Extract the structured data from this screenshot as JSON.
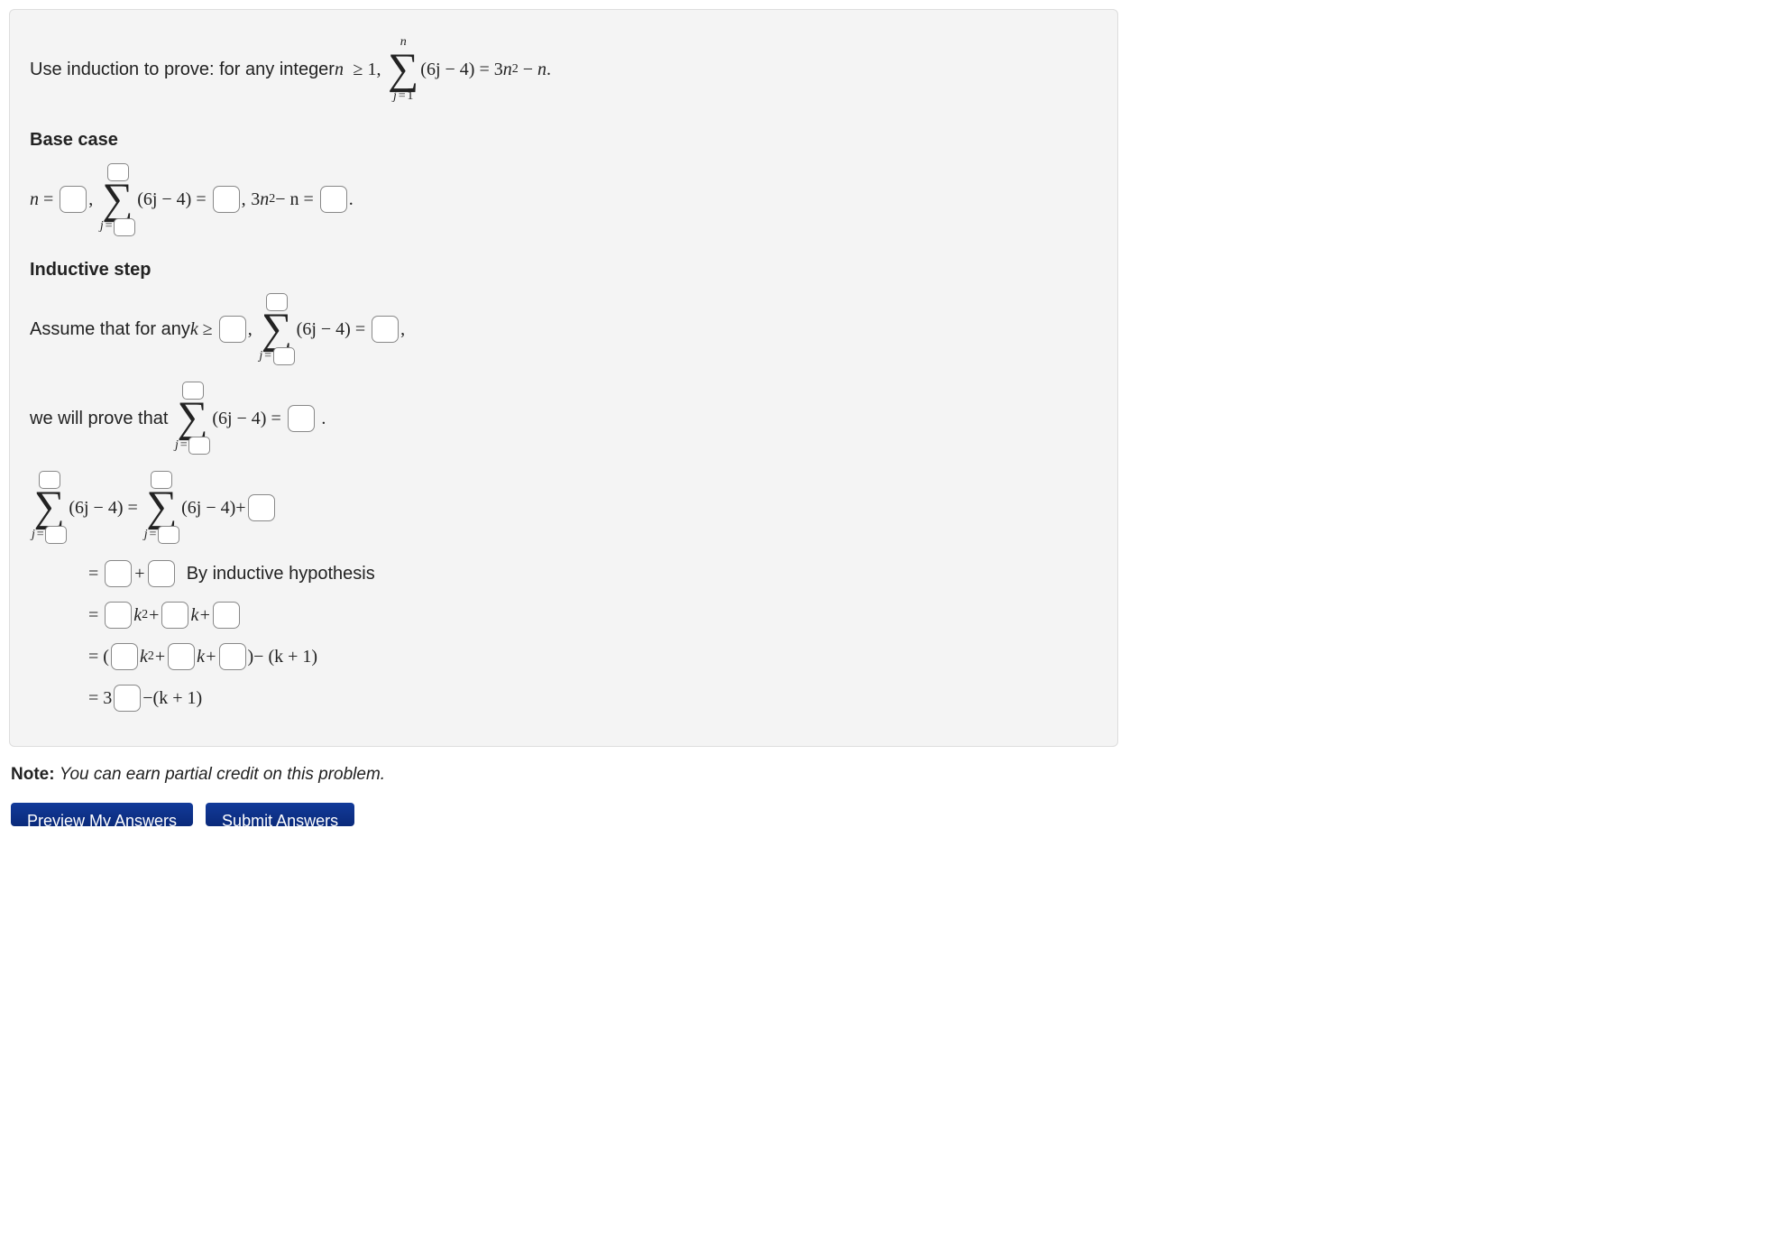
{
  "problem": {
    "prompt_prefix": "Use induction to prove: for any integer ",
    "var_n": "n",
    "geq": "≥",
    "one": "1",
    "comma": ",",
    "summand": "(6j − 4)",
    "eq": "=",
    "three": "3",
    "n_sq": "n",
    "sq": "2",
    "minus": "−",
    "period": "."
  },
  "base_case": {
    "heading": "Base case",
    "n_eq": "n",
    "eq": "=",
    "sum_lower_j": "j",
    "sum_lower_eq": "=",
    "summand": "(6j − 4)",
    "comma": ",",
    "three": "3",
    "n": "n",
    "sq": "2",
    "minus_n": " − n",
    "period": "."
  },
  "inductive": {
    "heading": "Inductive step",
    "assume_prefix": "Assume that for any ",
    "k": "k",
    "geq": "≥",
    "sum_lower_j": "j",
    "sum_lower_eq": "=",
    "summand": "(6j − 4)",
    "eq": "=",
    "comma": ",",
    "prove_prefix": "we will prove that ",
    "period": "."
  },
  "work": {
    "summand": "(6j − 4)",
    "summand_plus": "(6j − 4)+",
    "j": "j",
    "j_eq": "=",
    "eq": "=",
    "plus": "+",
    "by_hyp": "By inductive hypothesis",
    "k_sq": "k",
    "sq": "2",
    "k_plus": "k+",
    "open_paren": "(",
    "close_paren": ")",
    "minus_k1": " − (k + 1)",
    "three": "3",
    "final_suffix": "−(k + 1)"
  },
  "note": {
    "label": "Note:",
    "text": " You can earn partial credit on this problem."
  },
  "buttons": {
    "preview": "Preview My Answers",
    "submit": "Submit Answers"
  }
}
